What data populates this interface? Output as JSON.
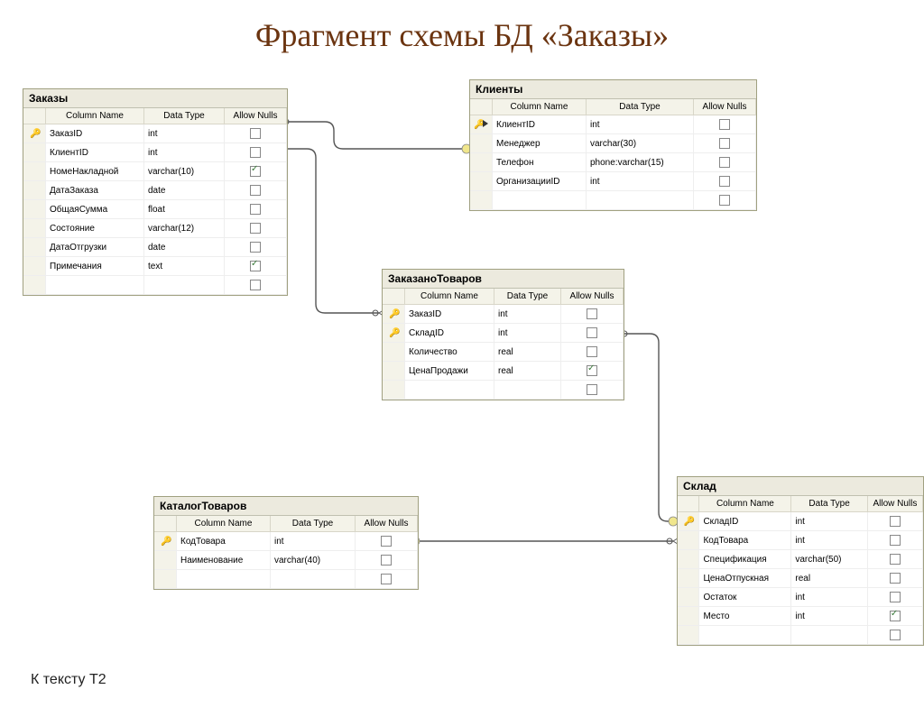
{
  "page": {
    "title": "Фрагмент схемы БД «Заказы»",
    "footnote": "К тексту Т2"
  },
  "headers": {
    "col_name": "Column Name",
    "data_type": "Data Type",
    "allow_nulls": "Allow Nulls"
  },
  "tables": {
    "orders": {
      "title": "Заказы",
      "rows": [
        {
          "key": true,
          "name": "ЗаказID",
          "type": "int",
          "nulls": false
        },
        {
          "key": false,
          "name": "КлиентID",
          "type": "int",
          "nulls": false
        },
        {
          "key": false,
          "name": "НомеНакладной",
          "type": "varchar(10)",
          "nulls": true
        },
        {
          "key": false,
          "name": "ДатаЗаказа",
          "type": "date",
          "nulls": false
        },
        {
          "key": false,
          "name": "ОбщаяСумма",
          "type": "float",
          "nulls": false
        },
        {
          "key": false,
          "name": "Состояние",
          "type": "varchar(12)",
          "nulls": false
        },
        {
          "key": false,
          "name": "ДатаОтгрузки",
          "type": "date",
          "nulls": false
        },
        {
          "key": false,
          "name": "Примечания",
          "type": "text",
          "nulls": true
        },
        {
          "key": false,
          "name": "",
          "type": "",
          "nulls": false
        }
      ]
    },
    "clients": {
      "title": "Клиенты",
      "rows": [
        {
          "key": true,
          "sel": true,
          "name": "КлиентID",
          "type": "int",
          "nulls": false
        },
        {
          "key": false,
          "name": "Менеджер",
          "type": "varchar(30)",
          "nulls": false
        },
        {
          "key": false,
          "name": "Телефон",
          "type": "phone:varchar(15)",
          "nulls": false
        },
        {
          "key": false,
          "name": "ОрганизацииID",
          "type": "int",
          "nulls": false
        },
        {
          "key": false,
          "name": "",
          "type": "",
          "nulls": false
        }
      ]
    },
    "ordered": {
      "title": "ЗаказаноТоваров",
      "rows": [
        {
          "key": true,
          "name": "ЗаказID",
          "type": "int",
          "nulls": false
        },
        {
          "key": true,
          "name": "СкладID",
          "type": "int",
          "nulls": false
        },
        {
          "key": false,
          "name": "Количество",
          "type": "real",
          "nulls": false
        },
        {
          "key": false,
          "name": "ЦенаПродажи",
          "type": "real",
          "nulls": true
        },
        {
          "key": false,
          "name": "",
          "type": "",
          "nulls": false
        }
      ]
    },
    "catalog": {
      "title": "КаталогТоваров",
      "rows": [
        {
          "key": true,
          "name": "КодТовара",
          "type": "int",
          "nulls": false
        },
        {
          "key": false,
          "name": "Наименование",
          "type": "varchar(40)",
          "nulls": false
        },
        {
          "key": false,
          "name": "",
          "type": "",
          "nulls": false
        }
      ]
    },
    "stock": {
      "title": "Склад",
      "rows": [
        {
          "key": true,
          "name": "СкладID",
          "type": "int",
          "nulls": false
        },
        {
          "key": false,
          "name": "КодТовара",
          "type": "int",
          "nulls": false
        },
        {
          "key": false,
          "name": "Спецификация",
          "type": "varchar(50)",
          "nulls": false
        },
        {
          "key": false,
          "name": "ЦенаОтпускная",
          "type": "real",
          "nulls": false
        },
        {
          "key": false,
          "name": "Остаток",
          "type": "int",
          "nulls": false
        },
        {
          "key": false,
          "name": "Место",
          "type": "int",
          "nulls": true
        },
        {
          "key": false,
          "name": "",
          "type": "",
          "nulls": false
        }
      ]
    }
  },
  "relations": [
    {
      "from": "orders.КлиентID",
      "to": "clients.КлиентID"
    },
    {
      "from": "ordered.ЗаказID",
      "to": "orders.ЗаказID"
    },
    {
      "from": "ordered.СкладID",
      "to": "stock.СкладID"
    },
    {
      "from": "stock.КодТовара",
      "to": "catalog.КодТовара"
    }
  ]
}
